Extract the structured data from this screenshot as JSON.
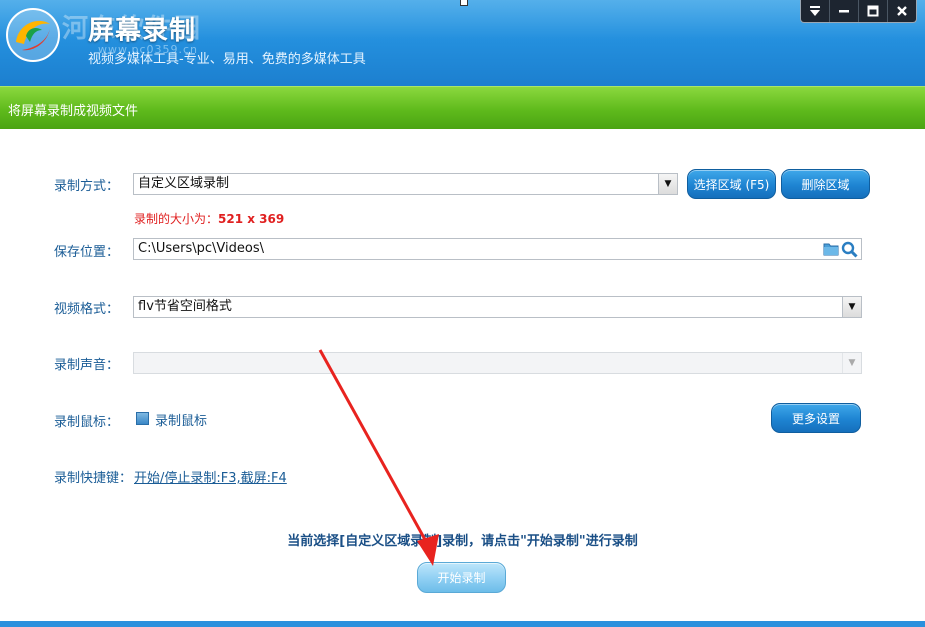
{
  "header": {
    "app_title": "屏幕录制",
    "subtitle": "视频多媒体工具-专业、易用、免费的多媒体工具",
    "watermark": "河东软件园",
    "watermark_url": "www.pc0359.cn",
    "window_controls": [
      "menu-icon",
      "minimize-icon",
      "maximize-icon",
      "close-icon"
    ],
    "brand_color": "#2490de"
  },
  "section": {
    "title": "将屏幕录制成视频文件",
    "color": "#5fba1c"
  },
  "form": {
    "mode": {
      "label": "录制方式：",
      "value": "自定义区域录制",
      "select_area_button": "选择区域 (F5)",
      "delete_area_button": "删除区域"
    },
    "size_note": {
      "prefix": "录制的大小为：",
      "value": "521 x 369",
      "color": "#e02020"
    },
    "save_location": {
      "label": "保存位置：",
      "value": "C:\\Users\\pc\\Videos\\"
    },
    "video_format": {
      "label": "视频格式：",
      "value": "flv节省空间格式"
    },
    "audio": {
      "label": "录制声音：",
      "value": ""
    },
    "mouse": {
      "label": "录制鼠标：",
      "checkbox_label": "录制鼠标",
      "more_settings_button": "更多设置"
    },
    "hotkeys": {
      "label": "录制快捷键：",
      "value": "开始/停止录制:F3,截屏:F4"
    }
  },
  "status_message": "当前选择[自定义区域录制]录制，请点击\"开始录制\"进行录制",
  "start_button": "开始录制",
  "annotation_color": "#e8231f"
}
